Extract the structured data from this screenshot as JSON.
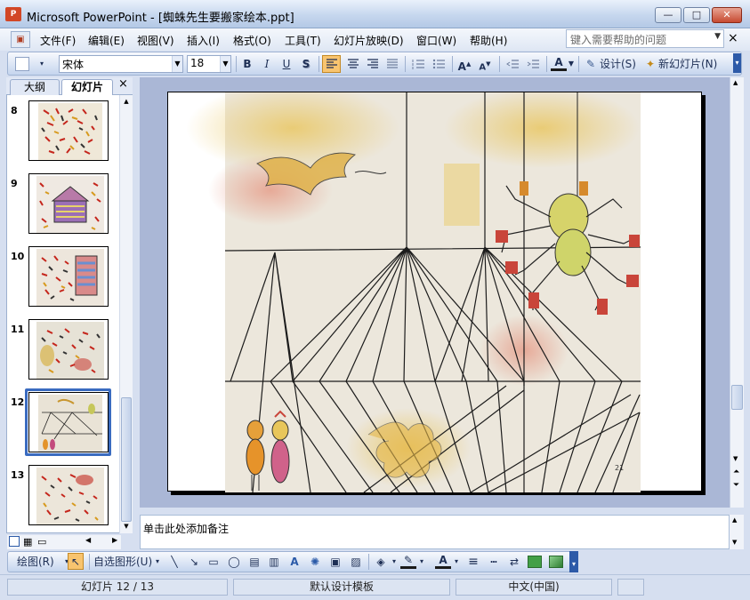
{
  "window": {
    "app_icon_label": "P",
    "title": "Microsoft PowerPoint - [蜘蛛先生要搬家绘本.ppt]",
    "minimize": "—",
    "maximize": "□",
    "close": "✕"
  },
  "menu": {
    "items": [
      "文件(F)",
      "编辑(E)",
      "视图(V)",
      "插入(I)",
      "格式(O)",
      "工具(T)",
      "幻灯片放映(D)",
      "窗口(W)",
      "帮助(H)"
    ],
    "help_placeholder": "键入需要帮助的问题",
    "doc_close": "×"
  },
  "format_toolbar": {
    "font_name": "宋体",
    "font_size": "18",
    "bold": "B",
    "italic": "I",
    "underline": "U",
    "shadow": "S",
    "design_label": "设计(S)",
    "new_slide_label": "新幻灯片(N)"
  },
  "left_pane": {
    "tabs": [
      "大纲",
      "幻灯片"
    ],
    "close": "×",
    "slides": [
      {
        "number": "8"
      },
      {
        "number": "9"
      },
      {
        "number": "10"
      },
      {
        "number": "11"
      },
      {
        "number": "12",
        "selected": true
      },
      {
        "number": "13"
      }
    ]
  },
  "slide": {
    "page_mark": "21"
  },
  "notes": {
    "placeholder": "单击此处添加备注"
  },
  "draw_toolbar": {
    "draw_label": "绘图(R)",
    "autoshape_label": "自选图形(U)"
  },
  "status": {
    "slide_position": "幻灯片 12 / 13",
    "template": "默认设计模板",
    "language": "中文(中国)"
  }
}
